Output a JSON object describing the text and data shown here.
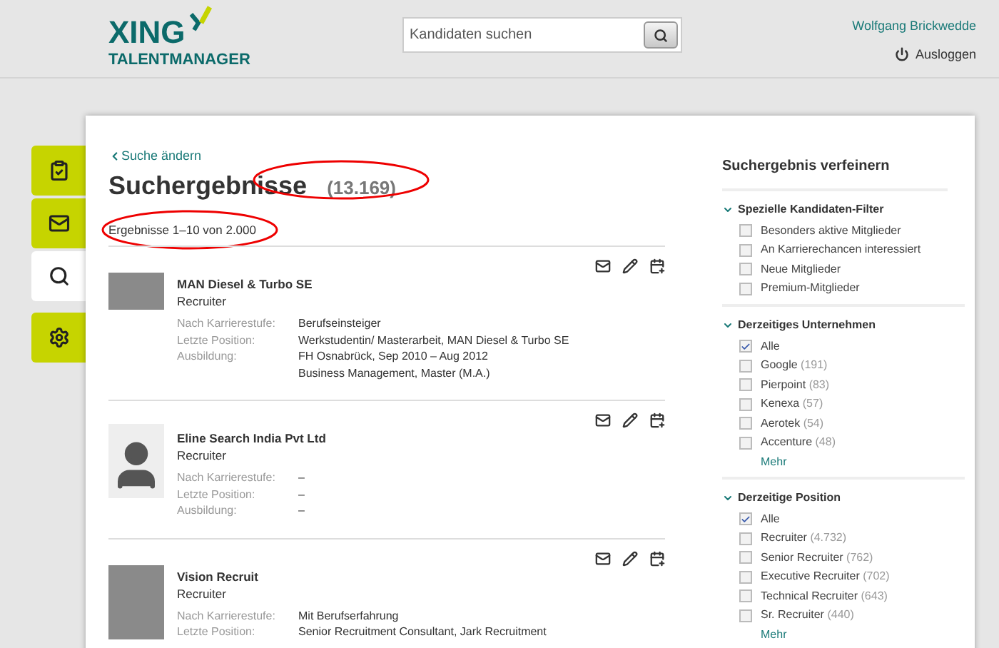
{
  "header": {
    "logo_word": "XING",
    "logo_sub": "TALENTMANAGER",
    "search": {
      "placeholder": "Kandidaten suchen"
    },
    "user_name": "Wolfgang Brickwedde",
    "logout": "Ausloggen"
  },
  "side_tabs": [
    {
      "kind": "tasks",
      "selected": false
    },
    {
      "kind": "mail",
      "selected": false
    },
    {
      "kind": "search",
      "selected": true
    },
    {
      "kind": "settings",
      "selected": false
    }
  ],
  "back_link": "Suche ändern",
  "title": "Suchergebnisse",
  "total": "(13.169)",
  "range": "Ergebnisse 1–10 von 2.000",
  "results": [
    {
      "kind": "photo",
      "company": "MAN Diesel & Turbo SE",
      "role": "Recruiter",
      "details": [
        {
          "label": "Nach Karrierestufe:",
          "values": [
            "Berufseinsteiger"
          ]
        },
        {
          "label": "Letzte Position:",
          "values": [
            "Werkstudentin/ Masterarbeit, MAN Diesel & Turbo SE"
          ]
        },
        {
          "label": "Ausbildung:",
          "values": [
            "FH Osnabrück, Sep 2010 – Aug 2012",
            "Business Management, Master (M.A.)"
          ]
        }
      ]
    },
    {
      "kind": "silhouette",
      "company": "Eline Search India Pvt Ltd",
      "role": "Recruiter",
      "details": [
        {
          "label": "Nach Karrierestufe:",
          "values": [
            "–"
          ]
        },
        {
          "label": "Letzte Position:",
          "values": [
            "–"
          ]
        },
        {
          "label": "Ausbildung:",
          "values": [
            "–"
          ]
        }
      ]
    },
    {
      "kind": "photo",
      "company": "Vision Recruit",
      "role": "Recruiter",
      "details": [
        {
          "label": "Nach Karrierestufe:",
          "values": [
            "Mit Berufserfahrung"
          ]
        },
        {
          "label": "Letzte Position:",
          "values": [
            "Senior Recruitment Consultant, Jark Recruitment"
          ]
        }
      ]
    }
  ],
  "filters": {
    "title": "Suchergebnis verfeinern",
    "groups": [
      {
        "title": "Spezielle Kandidaten-Filter",
        "expanded": true,
        "items": [
          {
            "label": "Besonders aktive Mitglieder",
            "checked": false
          },
          {
            "label": "An Karrierechancen interessiert",
            "checked": false
          },
          {
            "label": "Neue Mitglieder",
            "checked": false
          },
          {
            "label": "Premium-Mitglieder",
            "checked": false
          }
        ]
      },
      {
        "title": "Derzeitiges Unternehmen",
        "expanded": true,
        "items": [
          {
            "label": "Alle",
            "checked": true
          },
          {
            "label": "Google",
            "count": "(191)",
            "checked": false
          },
          {
            "label": "Pierpoint",
            "count": "(83)",
            "checked": false
          },
          {
            "label": "Kenexa",
            "count": "(57)",
            "checked": false
          },
          {
            "label": "Aerotek",
            "count": "(54)",
            "checked": false
          },
          {
            "label": "Accenture",
            "count": "(48)",
            "checked": false
          }
        ],
        "more": "Mehr"
      },
      {
        "title": "Derzeitige Position",
        "expanded": true,
        "items": [
          {
            "label": "Alle",
            "checked": true
          },
          {
            "label": "Recruiter",
            "count": "(4.732)",
            "checked": false
          },
          {
            "label": "Senior Recruiter",
            "count": "(762)",
            "checked": false
          },
          {
            "label": "Executive Recruiter",
            "count": "(702)",
            "checked": false
          },
          {
            "label": "Technical Recruiter",
            "count": "(643)",
            "checked": false
          },
          {
            "label": "Sr. Recruiter",
            "count": "(440)",
            "checked": false
          }
        ],
        "more": "Mehr"
      }
    ]
  }
}
